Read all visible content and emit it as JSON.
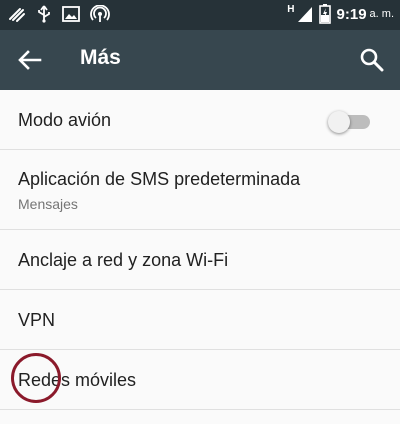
{
  "status_bar": {
    "time": "9:19",
    "ampm": "a. m.",
    "network_letter": "H",
    "left_icons": [
      "swipe-gesture-icon",
      "usb-icon",
      "image-icon",
      "hotspot-icon"
    ],
    "right_icons": [
      "cellular-signal-icon",
      "battery-charging-icon"
    ]
  },
  "app_bar": {
    "title": "Más",
    "back_icon": "arrow-back-icon",
    "search_icon": "search-icon",
    "background": "#37474f"
  },
  "settings": {
    "items": [
      {
        "label": "Modo avión",
        "toggle": false
      },
      {
        "label": "Aplicación de SMS predeterminada",
        "summary": "Mensajes"
      },
      {
        "label": "Anclaje a red y zona Wi-Fi"
      },
      {
        "label": "VPN"
      },
      {
        "label": "Redes móviles"
      }
    ]
  },
  "annotation": {
    "circle_color": "#8b1a2b"
  }
}
